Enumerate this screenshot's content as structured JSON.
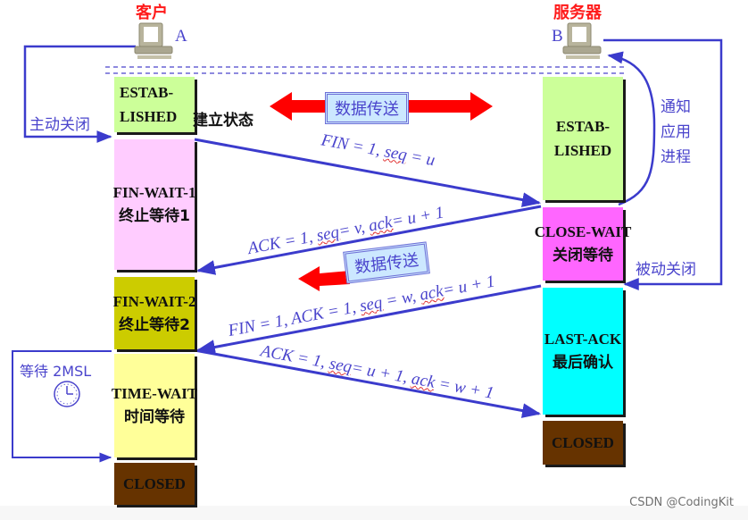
{
  "hosts": {
    "client": {
      "title": "客户",
      "letter": "A"
    },
    "server": {
      "title": "服务器",
      "letter": "B"
    }
  },
  "client_states": [
    {
      "en": "ESTAB-",
      "en2": "LISHED",
      "zh": "",
      "color": "#ccff99"
    },
    {
      "en": "FIN-WAIT-1",
      "en2": "",
      "zh": "终止等待1",
      "color": "#ffccff"
    },
    {
      "en": "FIN-WAIT-2",
      "en2": "",
      "zh": "终止等待2",
      "color": "#cccc00"
    },
    {
      "en": "TIME-WAIT",
      "en2": "",
      "zh": "时间等待",
      "color": "#ffff99"
    },
    {
      "en": "CLOSED",
      "en2": "",
      "zh": "",
      "color": "#663300"
    }
  ],
  "server_states": [
    {
      "en": "ESTAB-",
      "en2": "LISHED",
      "zh": "",
      "color": "#ccff99"
    },
    {
      "en": "CLOSE-WAIT",
      "en2": "",
      "zh": "关闭等待",
      "color": "#ff66ff"
    },
    {
      "en": "LAST-ACK",
      "en2": "",
      "zh": "最后确认",
      "color": "#00ffff"
    },
    {
      "en": "CLOSED",
      "en2": "",
      "zh": "",
      "color": "#663300"
    }
  ],
  "labels": {
    "established_zh": "建立状态",
    "active_close": "主动关闭",
    "passive_close": "被动关闭",
    "notify_app": [
      "通知",
      "应用",
      "进程"
    ],
    "wait_2msl": "等待 2MSL",
    "data_transfer": "数据传送"
  },
  "messages": [
    {
      "pre": "FIN = 1, ",
      "u": "seq",
      "post": " = u"
    },
    {
      "pre": "ACK = 1, ",
      "u": "seq",
      "mid": "= v, ",
      "u2": "ack",
      "post": "= u + 1"
    },
    {
      "pre": "FIN = 1, ACK = 1, ",
      "u": "seq",
      "mid": " = w, ",
      "u2": "ack",
      "post": "= u + 1"
    },
    {
      "pre": "ACK = 1, ",
      "u": "seq",
      "mid": "= u + 1, ",
      "u2": "ack",
      "post": " = w + 1"
    }
  ],
  "watermark": "CSDN @CodingKit",
  "colors": {
    "arrow_blue": "#3b3bcc",
    "data_red": "#ff0000"
  }
}
